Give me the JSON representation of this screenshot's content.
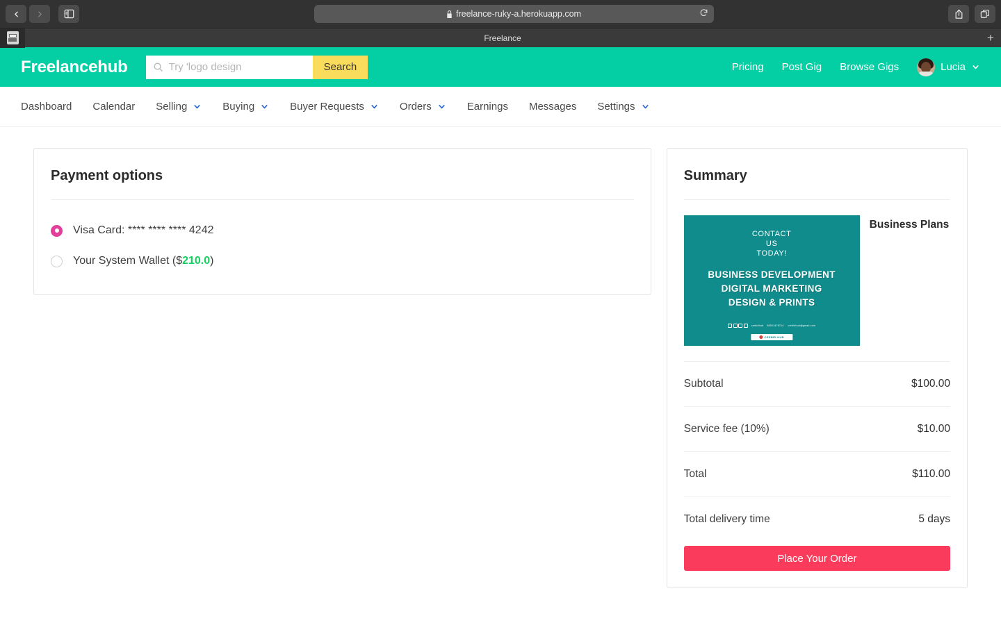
{
  "browser": {
    "url": "freelance-ruky-a.herokuapp.com",
    "tab_title": "Freelance",
    "back_icon": "chevron-left-icon",
    "forward_icon": "chevron-right-icon",
    "sidebar_icon": "sidebar-toggle-icon",
    "lock_icon": "lock-icon",
    "reload_icon": "reload-icon",
    "share_icon": "share-icon",
    "tabs_icon": "tab-overview-icon",
    "new_tab_label": "+"
  },
  "header": {
    "brand": "Freelancehub",
    "search": {
      "placeholder": "Try 'logo design",
      "value": "",
      "submit_label": "Search",
      "icon": "search-icon"
    },
    "links": [
      "Pricing",
      "Post Gig",
      "Browse Gigs"
    ],
    "user": {
      "name": "Lucia",
      "avatar": "user-avatar",
      "chevron": "chevron-down-icon"
    },
    "accent_color": "#04cea4",
    "search_button_color": "#f9dc5c"
  },
  "nav": {
    "items": [
      {
        "label": "Dashboard",
        "has_chevron": false
      },
      {
        "label": "Calendar",
        "has_chevron": false
      },
      {
        "label": "Selling",
        "has_chevron": true
      },
      {
        "label": "Buying",
        "has_chevron": true
      },
      {
        "label": "Buyer Requests",
        "has_chevron": true
      },
      {
        "label": "Orders",
        "has_chevron": true
      },
      {
        "label": "Earnings",
        "has_chevron": false
      },
      {
        "label": "Messages",
        "has_chevron": false
      },
      {
        "label": "Settings",
        "has_chevron": true
      }
    ]
  },
  "payment": {
    "title": "Payment options",
    "options": [
      {
        "label": "Visa Card: **** **** **** 4242",
        "selected": true
      },
      {
        "label_pre": "Your System Wallet ($",
        "amount": "210.0",
        "label_post": ")",
        "selected": false
      }
    ],
    "selected_color": "#e2409a",
    "amount_color": "#19cf5e"
  },
  "summary": {
    "title": "Summary",
    "gig": {
      "title": "Business Plans",
      "thumbnail": {
        "contact_line": "CONTACT\nUS\nTODAY!",
        "contact_l1": "CONTACT",
        "contact_l2": "US",
        "contact_l3": "TODAY!",
        "headline_1": "BUSINESS DEVELOPMENT",
        "headline_2": "DIGITAL MARKETING",
        "headline_3": "DESIGN & PRINTS",
        "handle": "crebidhub",
        "phone": "08021478714",
        "email": "crebidhub@gmail.com",
        "logo_text": "CREBID-HUB",
        "background_color": "#118c8c"
      }
    },
    "rows": [
      {
        "label": "Subtotal",
        "value": "$100.00"
      },
      {
        "label": "Service fee (10%)",
        "value": "$10.00"
      },
      {
        "label": "Total",
        "value": "$110.00"
      },
      {
        "label": "Total delivery time",
        "value": "5 days"
      }
    ],
    "order_button": {
      "label": "Place Your Order",
      "color": "#fb3b5c"
    }
  }
}
